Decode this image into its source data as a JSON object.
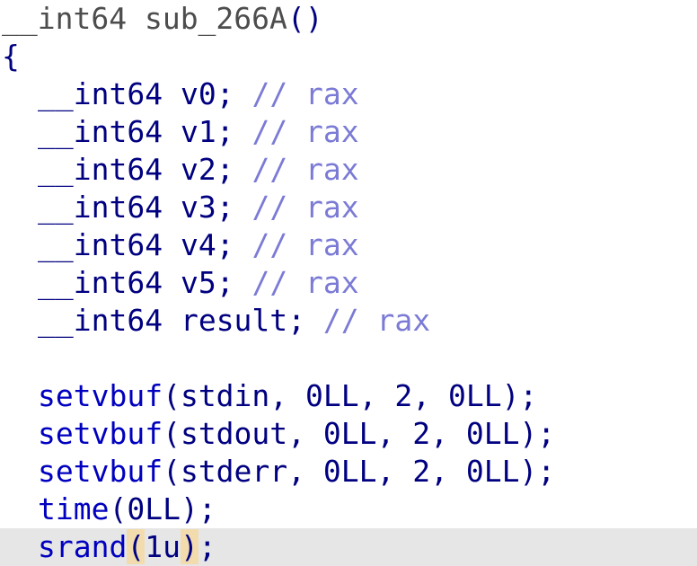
{
  "decompiler": {
    "signature": {
      "return_type": "__int64",
      "name": "sub_266A",
      "parens": "()"
    },
    "open_brace": "{",
    "declarations": [
      {
        "type": "__int64",
        "name": "v0",
        "semicolon": ";",
        "comment": "// rax"
      },
      {
        "type": "__int64",
        "name": "v1",
        "semicolon": ";",
        "comment": "// rax"
      },
      {
        "type": "__int64",
        "name": "v2",
        "semicolon": ";",
        "comment": "// rax"
      },
      {
        "type": "__int64",
        "name": "v3",
        "semicolon": ";",
        "comment": "// rax"
      },
      {
        "type": "__int64",
        "name": "v4",
        "semicolon": ";",
        "comment": "// rax"
      },
      {
        "type": "__int64",
        "name": "v5",
        "semicolon": ";",
        "comment": "// rax"
      },
      {
        "type": "__int64",
        "name": "result",
        "semicolon": ";",
        "comment": "// rax"
      }
    ],
    "statements": {
      "setvbuf_stdin": {
        "func": "setvbuf",
        "args": "(stdin, 0LL, 2, 0LL);"
      },
      "setvbuf_stdout": {
        "func": "setvbuf",
        "args": "(stdout, 0LL, 2, 0LL);"
      },
      "setvbuf_stderr": {
        "func": "setvbuf",
        "args": "(stderr, 0LL, 2, 0LL);"
      },
      "time": {
        "func": "time",
        "args": "(0LL);"
      },
      "srand": {
        "func": "srand",
        "open_paren": "(",
        "arg": "1u",
        "close_paren": ")",
        "end": ";"
      }
    },
    "colors": {
      "keyword_gray": "#4d4d4d",
      "identifier_navy": "#000080",
      "function_blue": "#0000c0",
      "comment_lavender": "#7b7bd6",
      "current_line": "#e6e6e6",
      "paren_highlight": "#f2dcae"
    }
  }
}
